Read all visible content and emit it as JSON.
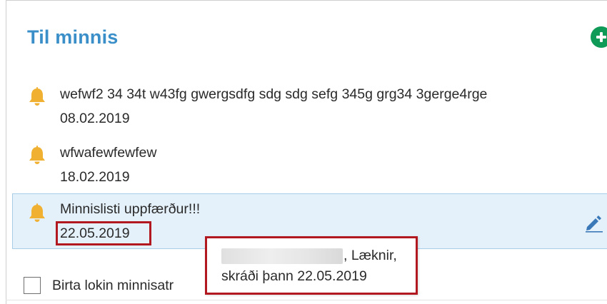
{
  "panel": {
    "title": "Til minnis",
    "add_icon": "plus-circle-icon"
  },
  "reminders": [
    {
      "text": "wefwf2 34 34t w43fg gwergsdfg sdg sdg sefg 345g grg34 3gerge4rge",
      "date": "08.02.2019",
      "icon": "bell-icon",
      "selected": false
    },
    {
      "text": "wfwafewfewfew",
      "date": "18.02.2019",
      "icon": "bell-icon",
      "selected": false
    },
    {
      "text": "Minnislisti uppfærður!!!",
      "date": "22.05.2019",
      "icon": "bell-icon",
      "selected": true,
      "edit_icon": "pencil-icon"
    }
  ],
  "show_completed": {
    "label": "Birta lokin minnisatr",
    "checked": false
  },
  "tooltip": {
    "line1": ", Læknir,",
    "line2": "skráði þann 22.05.2019"
  },
  "colors": {
    "title": "#3a8fc8",
    "add_button": "#0f9a57",
    "bell": "#f0b132",
    "selected_bg": "#e5f1fa",
    "highlight_border": "#b2181f"
  }
}
